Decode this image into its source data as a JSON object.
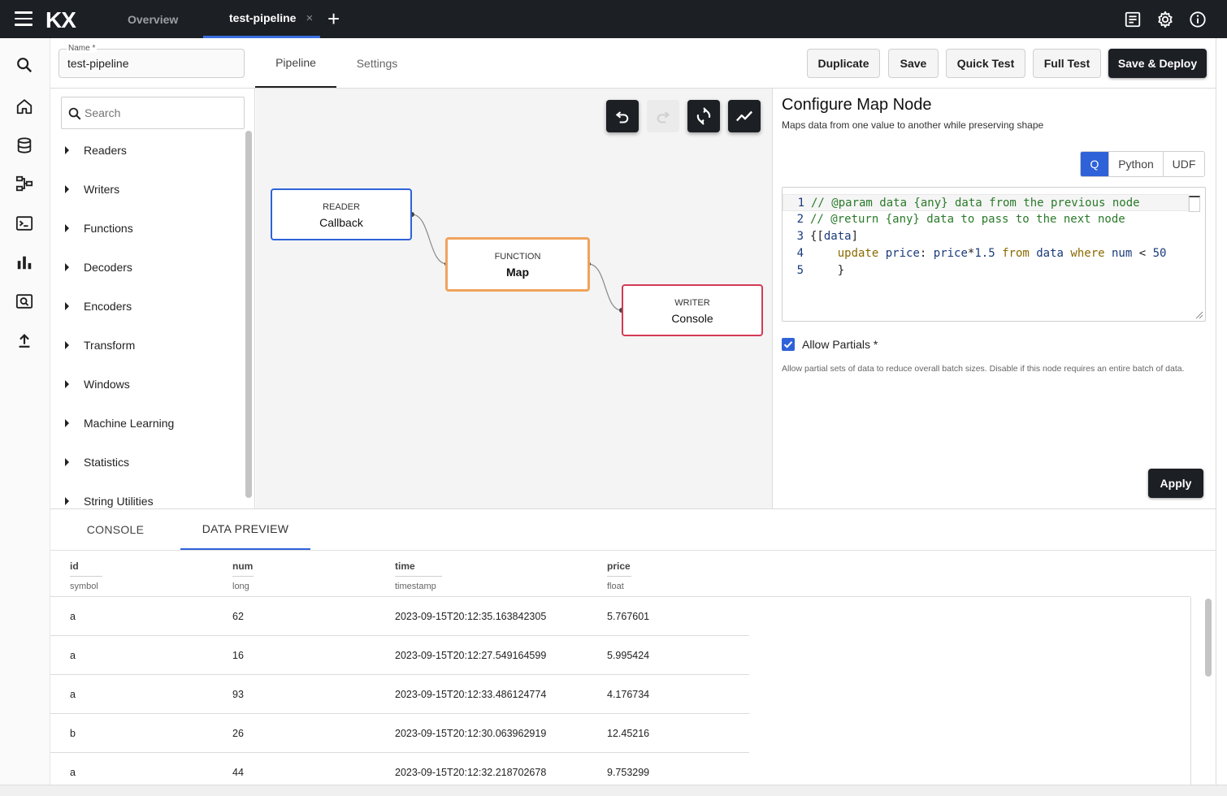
{
  "topbar": {
    "logo": "KX",
    "tabs": [
      {
        "label": "Overview"
      },
      {
        "label": "test-pipeline",
        "close": "×"
      }
    ],
    "add": "+"
  },
  "header": {
    "name_label": "Name *",
    "name_value": "test-pipeline",
    "tabs": [
      {
        "label": "Pipeline"
      },
      {
        "label": "Settings"
      }
    ],
    "buttons": {
      "duplicate": "Duplicate",
      "save": "Save",
      "quick_test": "Quick Test",
      "full_test": "Full Test",
      "save_deploy": "Save & Deploy"
    }
  },
  "palette": {
    "search_placeholder": "Search",
    "items": [
      "Readers",
      "Writers",
      "Functions",
      "Decoders",
      "Encoders",
      "Transform",
      "Windows",
      "Machine Learning",
      "Statistics",
      "String Utilities"
    ]
  },
  "canvas": {
    "nodes": [
      {
        "type": "READER",
        "name": "Callback",
        "color": "#2f62d8"
      },
      {
        "type": "FUNCTION",
        "name": "Map",
        "color": "#f0a35c"
      },
      {
        "type": "WRITER",
        "name": "Console",
        "color": "#d43a55"
      }
    ],
    "tools": [
      "undo-icon",
      "redo-icon",
      "refresh-layout-icon",
      "chart-line-icon"
    ]
  },
  "config": {
    "title": "Configure Map Node",
    "description": "Maps data from one value to another while preserving shape",
    "languages": [
      {
        "label": "Q"
      },
      {
        "label": "Python"
      },
      {
        "label": "UDF"
      }
    ],
    "active_language": "Q",
    "code": {
      "l1_num": "1",
      "l1": "// @param data {any} data from the previous node",
      "l2_num": "2",
      "l2": "// @return {any} data to pass to the next node",
      "l3_num": "3",
      "l3_a": "{[",
      "l3_b": "data",
      "l3_c": "]",
      "l4_num": "4",
      "l4_kw1": "update",
      "l4_v1": "price",
      "l4_op1": ":",
      "l4_v2": "price",
      "l4_op2": "*",
      "l4_n1": "1.5",
      "l4_kw2": "from",
      "l4_v3": "data",
      "l4_kw3": "where",
      "l4_v4": "num",
      "l4_op3": "<",
      "l4_n2": "50",
      "l5_num": "5",
      "l5": "}"
    },
    "allow_partials_label": "Allow Partials *",
    "allow_partials_checked": true,
    "allow_partials_help": "Allow partial sets of data to reduce overall batch sizes. Disable if this node requires an entire batch of data.",
    "apply": "Apply"
  },
  "bottom": {
    "tabs": [
      {
        "label": "CONSOLE"
      },
      {
        "label": "DATA PREVIEW"
      }
    ],
    "active_tab": "DATA PREVIEW",
    "columns": [
      {
        "name": "id",
        "type": "symbol"
      },
      {
        "name": "num",
        "type": "long"
      },
      {
        "name": "time",
        "type": "timestamp"
      },
      {
        "name": "price",
        "type": "float"
      }
    ],
    "rows": [
      [
        "a",
        "62",
        "2023-09-15T20:12:35.163842305",
        "5.767601"
      ],
      [
        "a",
        "16",
        "2023-09-15T20:12:27.549164599",
        "5.995424"
      ],
      [
        "a",
        "93",
        "2023-09-15T20:12:33.486124774",
        "4.176734"
      ],
      [
        "b",
        "26",
        "2023-09-15T20:12:30.063962919",
        "12.45216"
      ],
      [
        "a",
        "44",
        "2023-09-15T20:12:32.218702678",
        "9.753299"
      ]
    ]
  },
  "colors": {
    "accent": "#2f62d8",
    "topbar": "#1c1f24",
    "reader": "#2f62d8",
    "function": "#f0a35c",
    "writer": "#d43a55"
  }
}
